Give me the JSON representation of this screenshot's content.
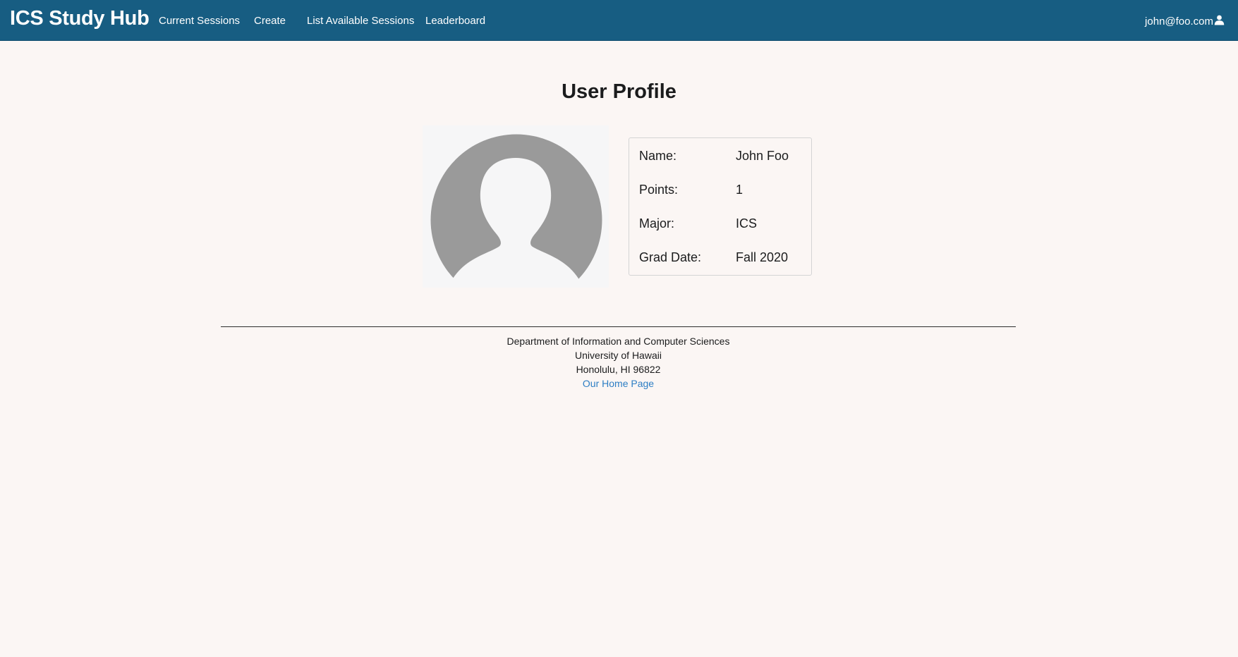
{
  "navbar": {
    "brand": "ICS Study Hub",
    "items": [
      {
        "label": "Current Sessions"
      },
      {
        "label": "Create"
      },
      {
        "label": "List Available Sessions"
      },
      {
        "label": "Leaderboard"
      }
    ],
    "user_email": "john@foo.com",
    "user_icon": "user-icon"
  },
  "main": {
    "title": "User Profile",
    "avatar_icon": "default-avatar-silhouette",
    "profile": [
      {
        "label": "Name:",
        "value": "John Foo"
      },
      {
        "label": "Points:",
        "value": "1"
      },
      {
        "label": "Major:",
        "value": "ICS"
      },
      {
        "label": "Grad Date:",
        "value": "Fall 2020"
      }
    ]
  },
  "footer": {
    "line1": "Department of Information and Computer Sciences",
    "line2": "University of Hawaii",
    "line3": "Honolulu, HI 96822",
    "link_label": "Our Home Page"
  },
  "colors": {
    "navbar_bg": "#175d82",
    "page_bg": "#fbf6f4",
    "link": "#2d7ec4",
    "avatar_gray": "#9a9a9a"
  }
}
